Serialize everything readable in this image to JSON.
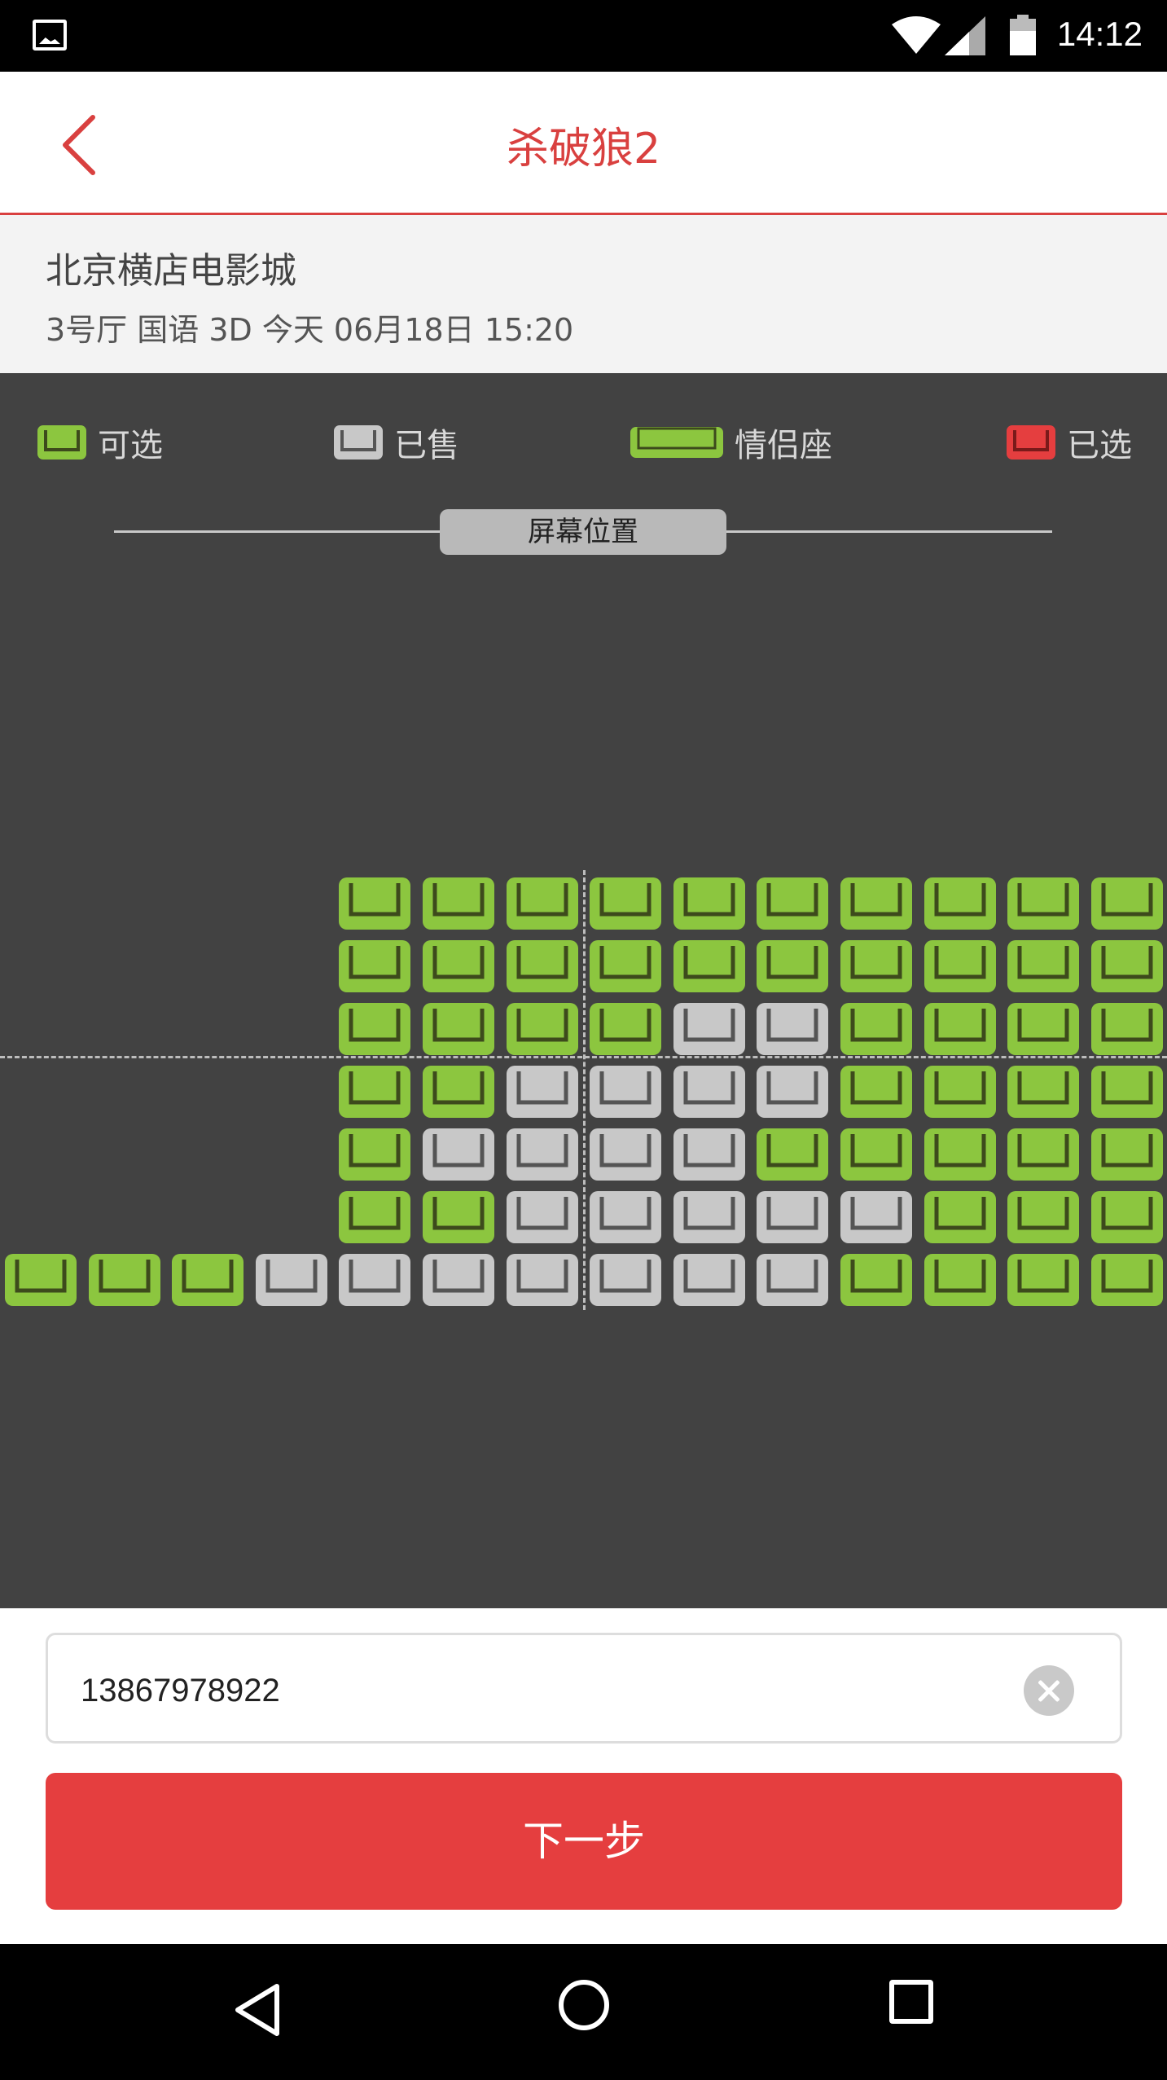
{
  "status_bar": {
    "time": "14:12"
  },
  "header": {
    "title": "杀破狼2"
  },
  "cinema": {
    "name": "北京横店电影城",
    "session": "3号厅 国语 3D 今天 06月18日 15:20"
  },
  "legend": {
    "available": "可选",
    "sold": "已售",
    "couple": "情侣座",
    "selected": "已选"
  },
  "screen_label": "屏幕位置",
  "colors": {
    "available": "#8cc63f",
    "sold": "#c8c8c8",
    "selected": "#e53e3f",
    "accent": "#d9403f"
  },
  "seat_rows": [
    {
      "row": 1,
      "seats": [
        "",
        "",
        "",
        "",
        "A",
        "A",
        "A",
        "A",
        "A",
        "A",
        "A",
        "A",
        "A",
        "A"
      ]
    },
    {
      "row": 2,
      "seats": [
        "",
        "",
        "",
        "",
        "A",
        "A",
        "A",
        "A",
        "A",
        "A",
        "A",
        "A",
        "A",
        "A"
      ]
    },
    {
      "row": 3,
      "seats": [
        "",
        "",
        "",
        "",
        "A",
        "A",
        "A",
        "A",
        "S",
        "S",
        "A",
        "A",
        "A",
        "A"
      ]
    },
    {
      "row": 4,
      "seats": [
        "",
        "",
        "",
        "",
        "A",
        "A",
        "S",
        "S",
        "S",
        "S",
        "A",
        "A",
        "A",
        "A"
      ]
    },
    {
      "row": 5,
      "seats": [
        "",
        "",
        "",
        "",
        "A",
        "S",
        "S",
        "S",
        "S",
        "A",
        "A",
        "A",
        "A",
        "A"
      ]
    },
    {
      "row": 6,
      "seats": [
        "",
        "",
        "",
        "",
        "A",
        "A",
        "S",
        "S",
        "S",
        "S",
        "S",
        "A",
        "A",
        "A"
      ]
    },
    {
      "row": 7,
      "seats": [
        "A",
        "A",
        "A",
        "S",
        "S",
        "S",
        "S",
        "S",
        "S",
        "S",
        "A",
        "A",
        "A",
        "A"
      ]
    }
  ],
  "form": {
    "phone_value": "13867978922",
    "next_label": "下一步"
  }
}
